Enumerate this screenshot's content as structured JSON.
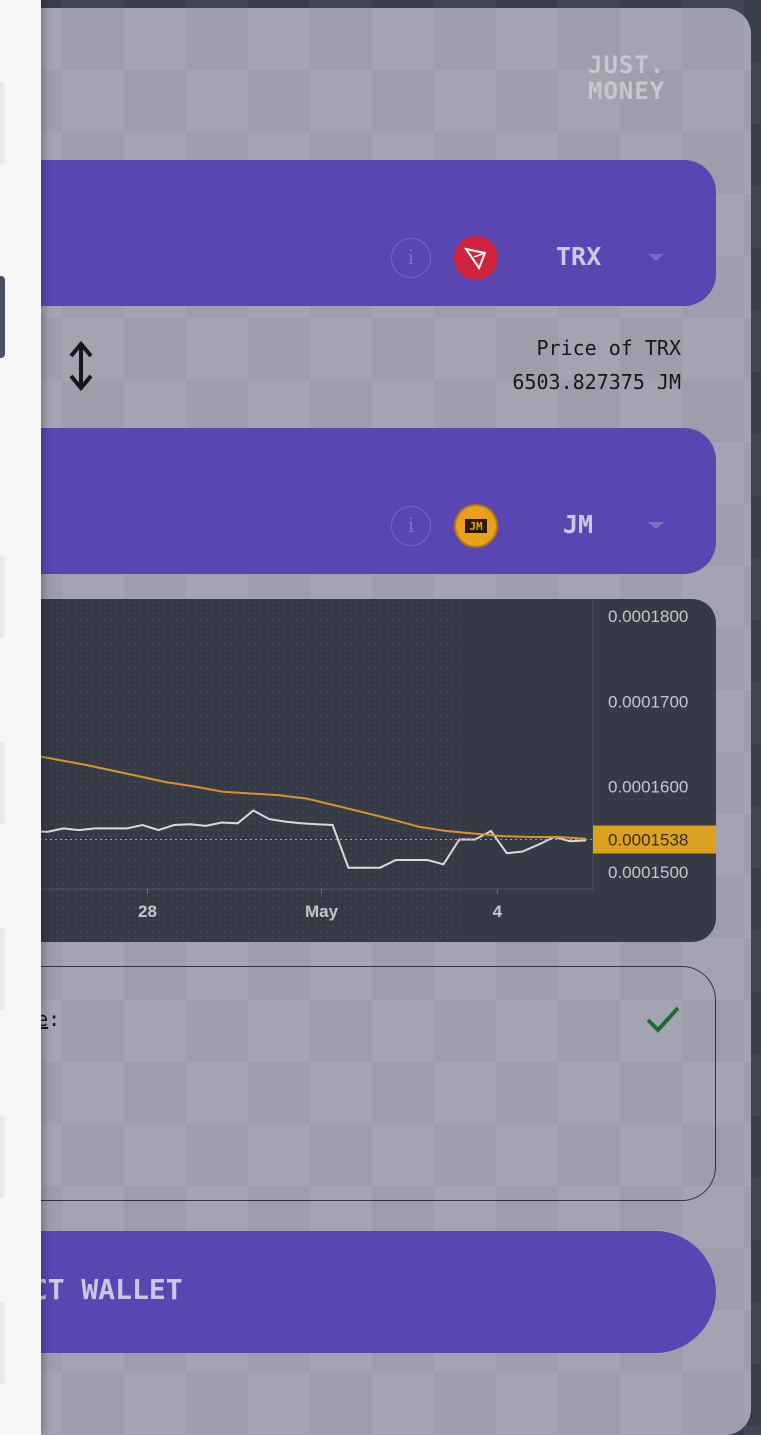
{
  "brand": {
    "logo_line1": "JUST.",
    "logo_line2": "MONEY"
  },
  "swap": {
    "from": {
      "token": "TRX",
      "token_icon": "tron-logo-icon"
    },
    "to": {
      "token": "JM",
      "token_icon": "jm-logo-icon"
    },
    "price_label": "Price of TRX",
    "price_value": "6503.827375 JM"
  },
  "chart_data": {
    "type": "line",
    "x_tick_labels": [
      "28",
      "May",
      "4"
    ],
    "y_tick_labels": [
      "0.0001800",
      "0.0001700",
      "0.0001600",
      "0.0001500"
    ],
    "ylim": [
      0.000148,
      0.000182
    ],
    "current_price_label": "0.0001538",
    "current_price": 0.0001538,
    "grid": false,
    "series": [
      {
        "values": [
          0.0001545,
          0.0001545,
          0.0001548,
          0.0001547,
          0.0001551,
          0.0001549,
          0.0001551,
          0.0001551,
          0.0001551,
          0.0001555,
          0.0001549,
          0.0001555,
          0.0001556,
          0.0001554,
          0.0001558,
          0.0001557,
          0.0001572,
          0.0001562,
          0.0001559,
          0.0001557,
          0.0001556,
          0.0001555,
          0.0001505,
          0.0001505,
          0.0001505,
          0.0001514,
          0.0001514,
          0.0001514,
          0.0001509,
          0.0001538,
          0.0001538,
          0.0001548,
          0.0001522,
          0.0001524,
          0.0001532,
          0.0001541,
          0.0001536,
          0.0001537
        ]
      },
      {
        "values": [
          0.0001642,
          0.0001638,
          0.0001632,
          0.0001626,
          0.0001619,
          0.0001612,
          0.0001605,
          0.00016,
          0.0001594,
          0.0001592,
          0.000159,
          0.0001586,
          0.0001578,
          0.000157,
          0.0001562,
          0.0001553,
          0.0001548,
          0.0001545,
          0.0001542,
          0.0001541,
          0.0001541,
          0.0001539
        ]
      }
    ]
  },
  "checks": {
    "label_visible_part": "ore",
    "label_suffix": ":"
  },
  "actions": {
    "connect_wallet_visible": "ECT WALLET"
  },
  "colors": {
    "accent_purple": "#5a46b2",
    "price_line": "#d9d9df",
    "ma_line": "#d9922a",
    "current_price_badge": "#dba21f",
    "check_green": "#1f6b2c"
  }
}
